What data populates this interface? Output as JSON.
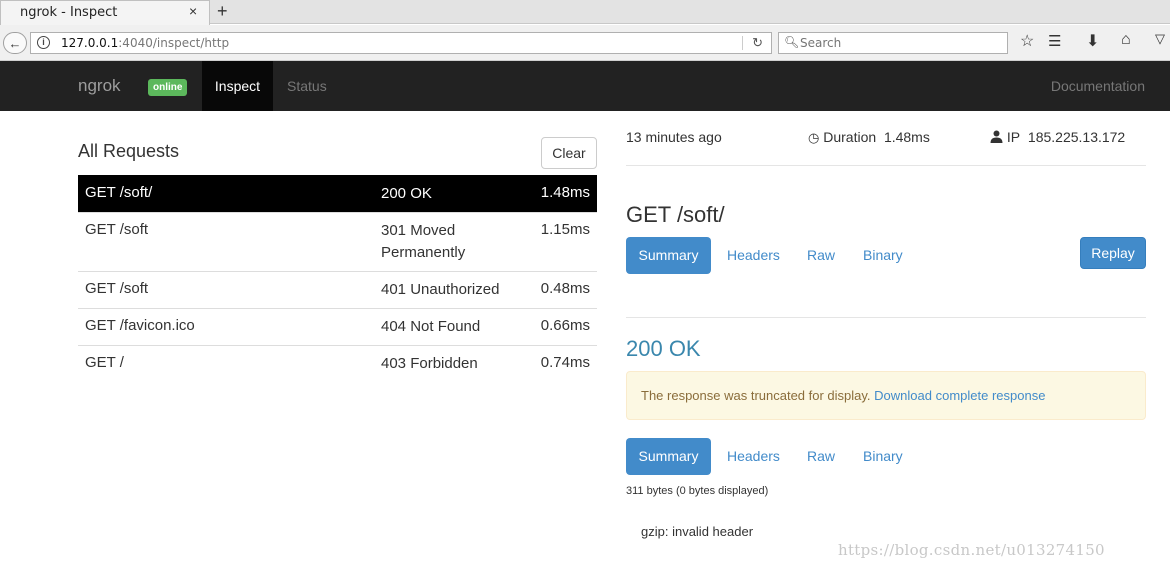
{
  "browser": {
    "tab_title": "ngrok - Inspect",
    "tab_close": "×",
    "new_tab": "+",
    "url_host": "127.0.0.1",
    "url_rest": ":4040/inspect/http",
    "search_placeholder": "Search"
  },
  "topnav": {
    "brand": "ngrok",
    "badge": "online",
    "items": [
      {
        "label": "Inspect"
      },
      {
        "label": "Status"
      }
    ],
    "docs": "Documentation"
  },
  "requests": {
    "title": "All Requests",
    "clear_label": "Clear",
    "rows": [
      {
        "path": "GET /soft/",
        "status": "200 OK",
        "duration": "1.48ms"
      },
      {
        "path": "GET /soft",
        "status": "301 Moved Permanently",
        "duration": "1.15ms"
      },
      {
        "path": "GET /soft",
        "status": "401 Unauthorized",
        "duration": "0.48ms"
      },
      {
        "path": "GET /favicon.ico",
        "status": "404 Not Found",
        "duration": "0.66ms"
      },
      {
        "path": "GET /",
        "status": "403 Forbidden",
        "duration": "0.74ms"
      }
    ]
  },
  "detail": {
    "time_ago": "13 minutes ago",
    "duration_label": "Duration",
    "duration_value": "1.48ms",
    "ip_label": "IP",
    "ip_value": "185.225.13.172",
    "request_title": "GET /soft/",
    "request_tabs": [
      "Summary",
      "Headers",
      "Raw",
      "Binary"
    ],
    "replay_label": "Replay",
    "response_title": "200 OK",
    "warning_text": "The response was truncated for display. ",
    "warning_link": "Download complete response",
    "response_tabs": [
      "Summary",
      "Headers",
      "Raw",
      "Binary"
    ],
    "bytes_text": "311 bytes (0 bytes displayed)",
    "body_text": "gzip: invalid header"
  },
  "watermark": "https://blog.csdn.net/u013274150"
}
